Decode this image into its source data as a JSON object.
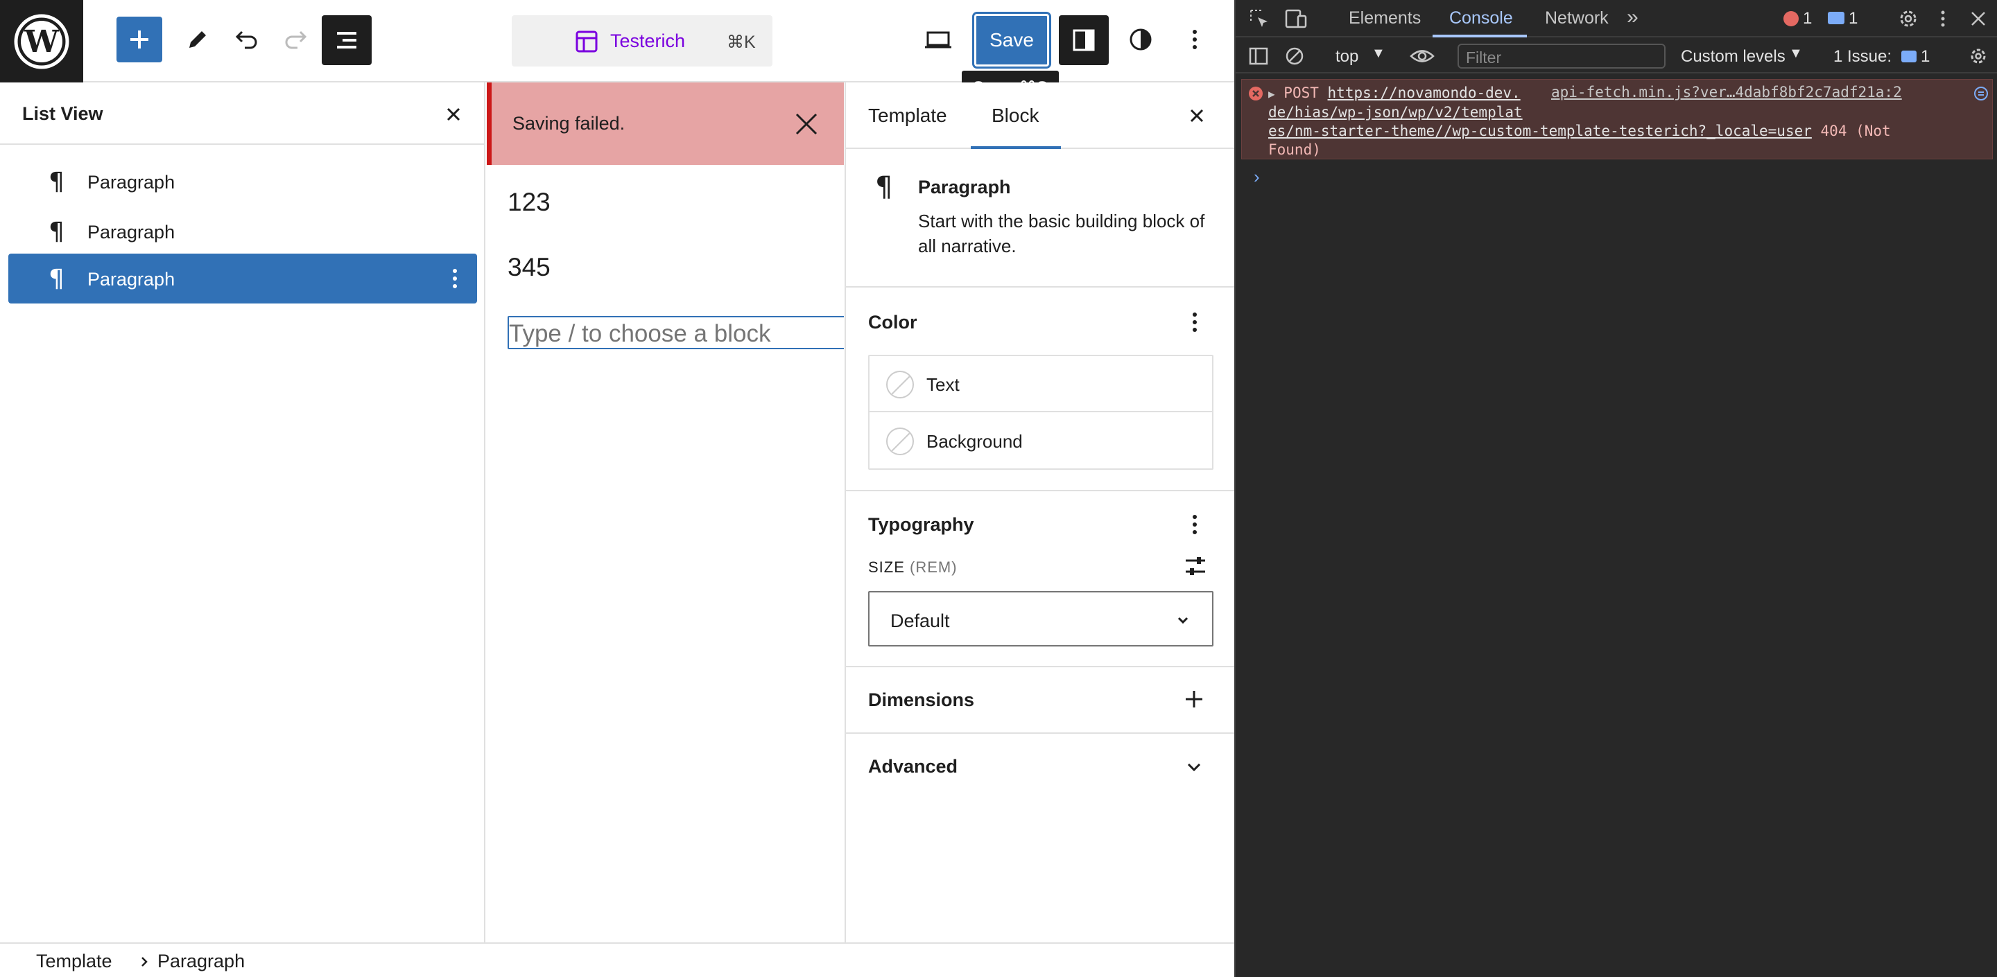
{
  "editor": {
    "toolbar": {
      "document_title": "Testerich",
      "command_shortcut": "⌘K",
      "save_label": "Save",
      "save_tooltip_label": "Save",
      "save_tooltip_shortcut": "⌘S"
    },
    "list_view": {
      "title": "List View",
      "items": [
        {
          "label": "Paragraph",
          "selected": false
        },
        {
          "label": "Paragraph",
          "selected": false
        },
        {
          "label": "Paragraph",
          "selected": true
        }
      ]
    },
    "canvas": {
      "notice": "Saving failed.",
      "paragraphs": [
        "123",
        "345"
      ],
      "placeholder": "Type / to choose a block"
    },
    "sidebar": {
      "tabs": [
        {
          "label": "Template",
          "active": false
        },
        {
          "label": "Block",
          "active": true
        }
      ],
      "block_card": {
        "title": "Paragraph",
        "description": "Start with the basic building block of all narrative."
      },
      "color": {
        "title": "Color",
        "options": [
          "Text",
          "Background"
        ]
      },
      "typography": {
        "title": "Typography",
        "size_label": "SIZE",
        "size_unit": "(REM)",
        "size_value": "Default"
      },
      "dimensions": {
        "title": "Dimensions"
      },
      "advanced": {
        "title": "Advanced"
      }
    },
    "breadcrumb": [
      "Template",
      "Paragraph"
    ],
    "colors": {
      "accent": "#3171b6",
      "notice_bg": "#e6a4a4",
      "notice_border": "#cc1818",
      "command_title": "#7a00df"
    }
  },
  "devtools": {
    "tabs": [
      "Elements",
      "Console",
      "Network"
    ],
    "active_tab": "Console",
    "error_count": "1",
    "message_count": "1",
    "context": "top",
    "filter_placeholder": "Filter",
    "levels": "Custom levels",
    "issues_label": "1 Issue:",
    "issues_count": "1",
    "error": {
      "method": "POST",
      "url_line1": "https://novamondo-dev.",
      "url_line2": "de/hias/wp-json/wp/v2/templat",
      "url_line3": "es/nm-starter-theme//wp-custom-template-testerich?_locale=user",
      "status": "404 (Not",
      "status2": "Found)",
      "source": "api-fetch.min.js?ver…4dabf8bf2c7adf21a:2"
    },
    "colors": {
      "background": "#282828",
      "error_bg": "#4e3534",
      "link": "#a8c7fa"
    }
  }
}
